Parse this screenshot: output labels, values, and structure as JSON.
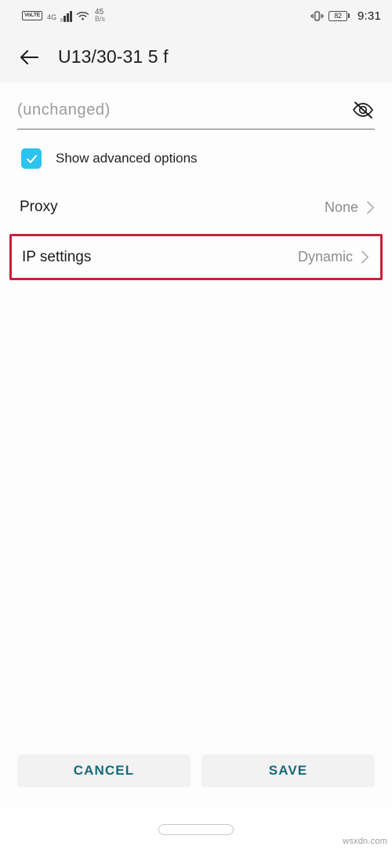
{
  "status_bar": {
    "volte_badge": "VoLTE",
    "network_type": "4G",
    "signal_icon": "signal-bars-icon",
    "wifi_icon": "wifi-icon",
    "speed_value": "45",
    "speed_unit": "B/s",
    "vibrate_icon": "vibrate-icon",
    "battery_level": "82",
    "time": "9:31"
  },
  "app_bar": {
    "back_icon": "back-arrow-icon",
    "title": "U13/30-31 5 f"
  },
  "form": {
    "password": {
      "value": "",
      "placeholder": "(unchanged)",
      "toggle_icon": "eye-off-icon"
    },
    "advanced_checkbox": {
      "label": "Show advanced options",
      "checked": true,
      "accent_color": "#2ec2ef",
      "check_icon": "checkmark-icon"
    },
    "rows": [
      {
        "label": "Proxy",
        "value": "None",
        "chevron_icon": "chevron-right-icon",
        "highlighted": false
      },
      {
        "label": "IP settings",
        "value": "Dynamic",
        "chevron_icon": "chevron-right-icon",
        "highlighted": true,
        "highlight_color": "#c8203c"
      }
    ]
  },
  "footer": {
    "cancel_label": "CANCEL",
    "save_label": "SAVE",
    "accent_color": "#16697a"
  },
  "nav_bar": {
    "home_indicator_icon": "home-indicator-pill"
  },
  "watermark": "wsxdn.com"
}
